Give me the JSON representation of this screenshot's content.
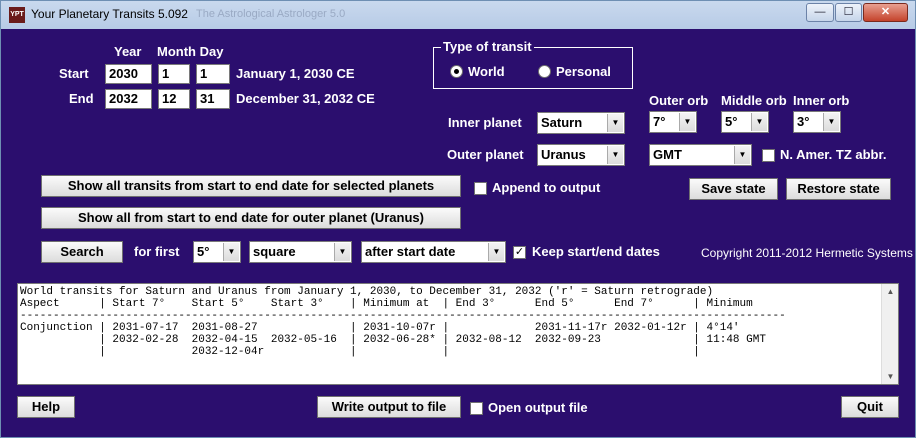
{
  "window": {
    "app_icon_text": "YPT",
    "title": "Your Planetary Transits 5.092",
    "ghost_title": "The Astrological Astrologer 5.0",
    "min_glyph": "—",
    "max_glyph": "☐",
    "close_glyph": "✕"
  },
  "dates": {
    "year_header": "Year",
    "month_day_header": "Month Day",
    "start_label": "Start",
    "end_label": "End",
    "start": {
      "year": "2030",
      "month": "1",
      "day": "1",
      "display": "January 1, 2030 CE"
    },
    "end": {
      "year": "2032",
      "month": "12",
      "day": "31",
      "display": "December 31, 2032 CE"
    }
  },
  "transit_type": {
    "title": "Type of transit",
    "options": [
      "World",
      "Personal"
    ],
    "selected": "World"
  },
  "orbs": {
    "outer_label": "Outer orb",
    "middle_label": "Middle orb",
    "inner_label": "Inner orb",
    "outer_value": "7°",
    "middle_value": "5°",
    "inner_value": "3°"
  },
  "planets": {
    "inner_label": "Inner planet",
    "inner_value": "Saturn",
    "outer_label": "Outer planet",
    "outer_value": "Uranus"
  },
  "timezone": {
    "value": "GMT",
    "abbr_label": "N. Amer. TZ abbr.",
    "abbr_checked": false
  },
  "actions": {
    "show_all_selected": "Show all transits from start to end date for selected planets",
    "show_all_outer": "Show all from start to end date for outer planet (Uranus)",
    "append_label": "Append to output",
    "append_checked": false,
    "save_state": "Save state",
    "restore_state": "Restore state"
  },
  "search": {
    "button": "Search",
    "for_first_label": "for first",
    "orb_value": "5°",
    "aspect_value": "square",
    "when_value": "after start date",
    "keep_label": "Keep start/end dates",
    "keep_checked": true,
    "keep_glyph": "✓"
  },
  "copyright": "Copyright 2011-2012 Hermetic Systems",
  "output": {
    "lines": [
      "World transits for Saturn and Uranus from January 1, 2030, to December 31, 2032 ('r' = Saturn retrograde)",
      "Aspect      | Start 7°    Start 5°    Start 3°    | Minimum at  | End 3°      End 5°      End 7°      | Minimum",
      "--------------------------------------------------------------------------------------------------------------------",
      "Conjunction | 2031-07-17  2031-08-27              | 2031-10-07r |             2031-11-17r 2032-01-12r | 4°14'",
      "            | 2032-02-28  2032-04-15  2032-05-16  | 2032-06-28* | 2032-08-12  2032-09-23              | 11:48 GMT",
      "            |             2032-12-04r             |             |                                     |"
    ]
  },
  "bottom": {
    "help": "Help",
    "write_output": "Write output to file",
    "open_output_label": "Open output file",
    "open_output_checked": false,
    "quit": "Quit"
  },
  "icons": {
    "dropdown_arrow": "▼",
    "scroll_up": "▲",
    "scroll_down": "▼"
  }
}
